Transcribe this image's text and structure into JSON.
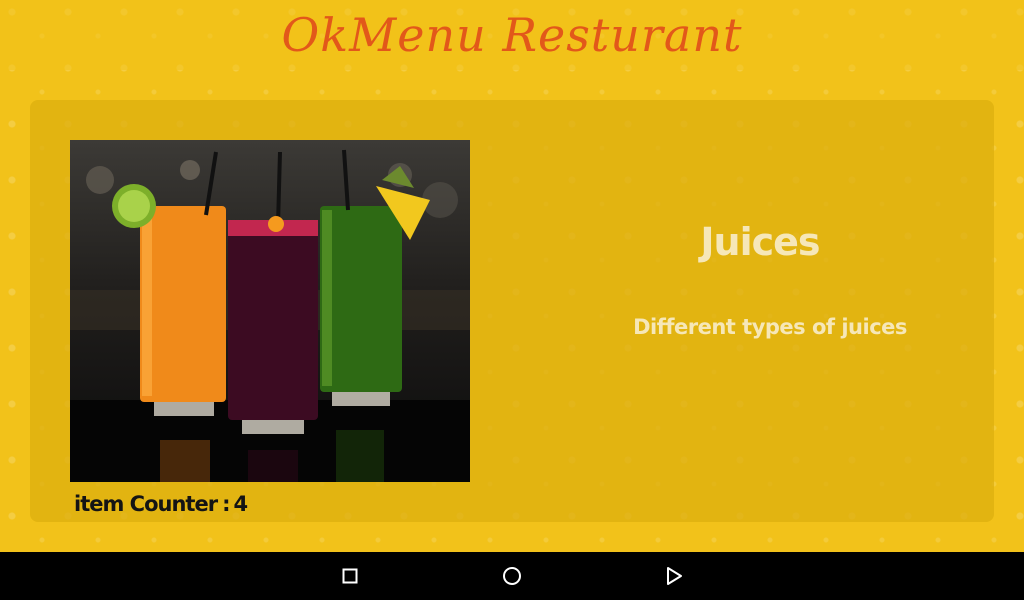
{
  "app": {
    "title": "OkMenu Resturant"
  },
  "item": {
    "name": "Juices",
    "description": "Different types of juices",
    "image_icon": "juices-photo"
  },
  "counter": {
    "label": "item Counter",
    "separator": ":",
    "value": "4"
  },
  "navbar": {
    "icons": [
      "recent-apps-icon",
      "home-icon",
      "back-icon"
    ]
  },
  "colors": {
    "background": "#F2C21A",
    "title": "#E2581A",
    "card_text": "#F6E7B8",
    "counter_text": "#141414"
  }
}
